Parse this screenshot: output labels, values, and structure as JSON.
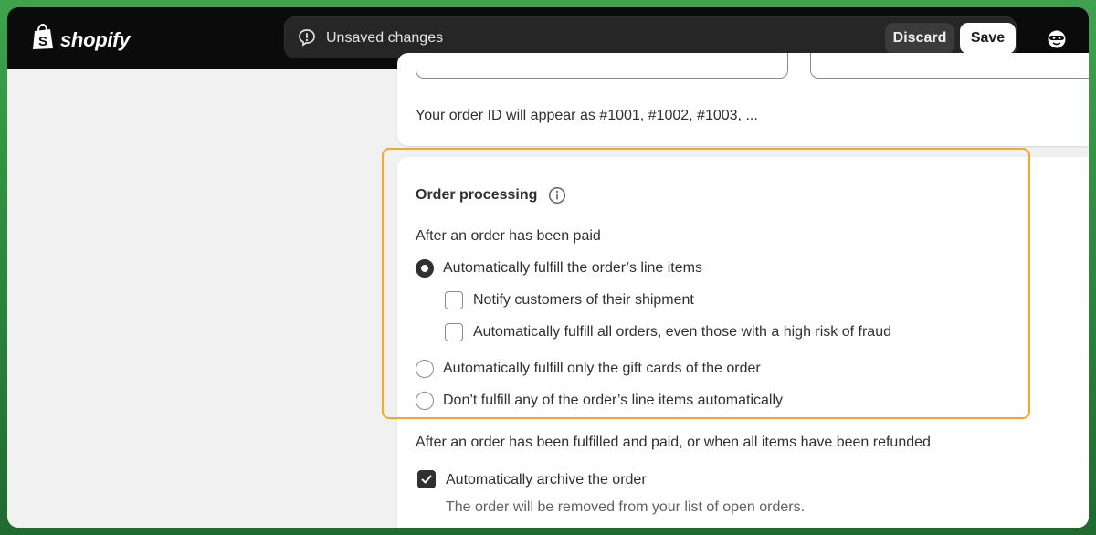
{
  "brand": {
    "name": "shopify"
  },
  "savebar": {
    "message": "Unsaved changes",
    "discard_label": "Discard",
    "save_label": "Save"
  },
  "order_id_card": {
    "note": "Your order ID will appear as #1001, #1002, #1003, ..."
  },
  "order_processing": {
    "title": "Order processing",
    "paid_heading": "After an order has been paid",
    "options": [
      {
        "label": "Automatically fulfill the order’s line items",
        "selected": true
      },
      {
        "label": "Automatically fulfill only the gift cards of the order",
        "selected": false
      },
      {
        "label": "Don’t fulfill any of the order’s line items automatically",
        "selected": false
      }
    ],
    "sub_options": [
      {
        "label": "Notify customers of their shipment",
        "checked": false
      },
      {
        "label": "Automatically fulfill all orders, even those with a high risk of fraud",
        "checked": false
      }
    ],
    "fulfilled_heading": "After an order has been fulfilled and paid, or when all items have been refunded",
    "archive": {
      "label": "Automatically archive the order",
      "checked": true,
      "help": "The order will be removed from your list of open orders."
    }
  },
  "colors": {
    "topbar": "#0b0b0b",
    "highlight": "#f0a92a",
    "background_green": "#2e8a3e"
  }
}
